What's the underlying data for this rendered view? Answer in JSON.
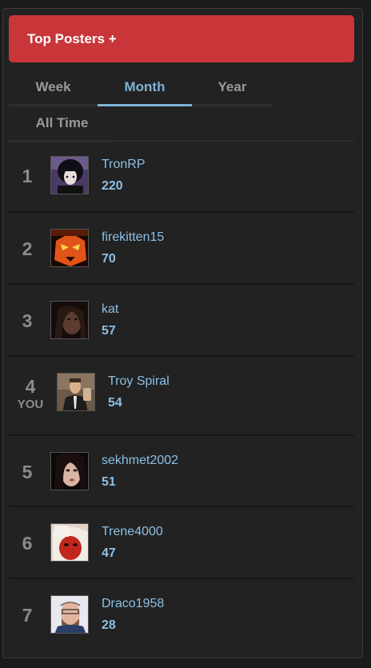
{
  "widget": {
    "title": "Top Posters +",
    "tabs": [
      {
        "label": "Week"
      },
      {
        "label": "Month"
      },
      {
        "label": "Year"
      },
      {
        "label": "All Time"
      }
    ],
    "active_tab": "Month",
    "you_label": "YOU"
  },
  "posters": [
    {
      "rank": "1",
      "name": "TronRP",
      "score": "220"
    },
    {
      "rank": "2",
      "name": "firekitten15",
      "score": "70"
    },
    {
      "rank": "3",
      "name": "kat",
      "score": "57"
    },
    {
      "rank": "4",
      "name": "Troy Spiral",
      "score": "54",
      "is_you": true
    },
    {
      "rank": "5",
      "name": "sekhmet2002",
      "score": "51"
    },
    {
      "rank": "6",
      "name": "Trene4000",
      "score": "47"
    },
    {
      "rank": "7",
      "name": "Draco1958",
      "score": "28"
    }
  ],
  "colors": {
    "header_bg": "#c9363a",
    "accent": "#7fb2d6",
    "link": "#8cc0e6",
    "panel_bg": "#222222"
  }
}
